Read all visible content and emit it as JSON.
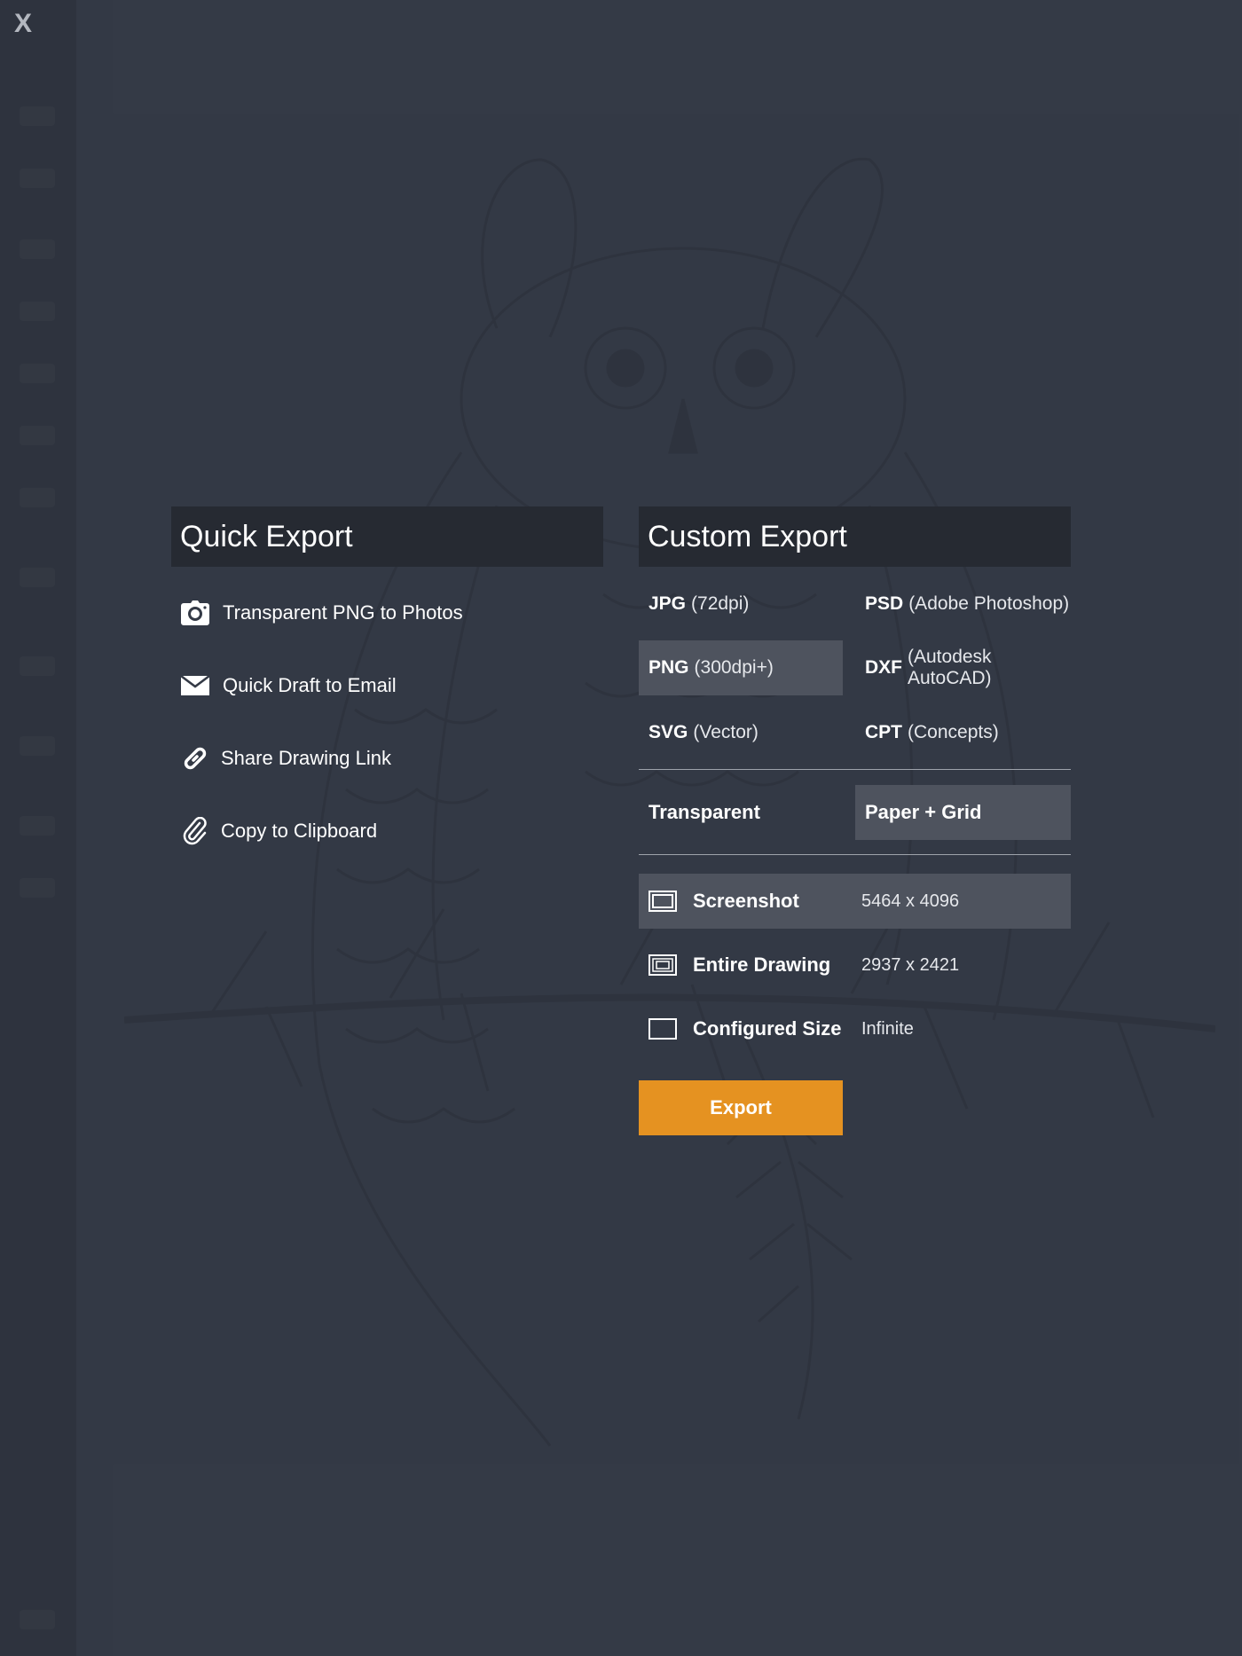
{
  "window": {
    "close_label": "X"
  },
  "quick_export": {
    "title": "Quick Export",
    "items": [
      {
        "icon": "camera-icon",
        "label": "Transparent PNG to Photos"
      },
      {
        "icon": "envelope-icon",
        "label": "Quick Draft to Email"
      },
      {
        "icon": "link-icon",
        "label": "Share Drawing Link"
      },
      {
        "icon": "paperclip-icon",
        "label": "Copy to Clipboard"
      }
    ]
  },
  "custom_export": {
    "title": "Custom Export",
    "formats": [
      {
        "name": "JPG",
        "desc": "(72dpi)",
        "selected": false
      },
      {
        "name": "PSD",
        "desc": "(Adobe Photoshop)",
        "selected": false
      },
      {
        "name": "PNG",
        "desc": "(300dpi+)",
        "selected": true
      },
      {
        "name": "DXF",
        "desc": "(Autodesk AutoCAD)",
        "selected": false
      },
      {
        "name": "SVG",
        "desc": "(Vector)",
        "selected": false
      },
      {
        "name": "CPT",
        "desc": "(Concepts)",
        "selected": false
      }
    ],
    "backgrounds": [
      {
        "label": "Transparent",
        "selected": false
      },
      {
        "label": "Paper + Grid",
        "selected": true
      }
    ],
    "sizes": [
      {
        "icon": "screenshot-frame-icon",
        "label": "Screenshot",
        "value": "5464 x 4096",
        "selected": true
      },
      {
        "icon": "entire-drawing-frame-icon",
        "label": "Entire Drawing",
        "value": "2937 x 2421",
        "selected": false
      },
      {
        "icon": "configured-size-frame-icon",
        "label": "Configured Size",
        "value": "Infinite",
        "selected": false
      }
    ],
    "export_label": "Export"
  },
  "colors": {
    "background": "#343a46",
    "header": "#262a32",
    "selected": "#4e535e",
    "accent": "#e59221"
  }
}
